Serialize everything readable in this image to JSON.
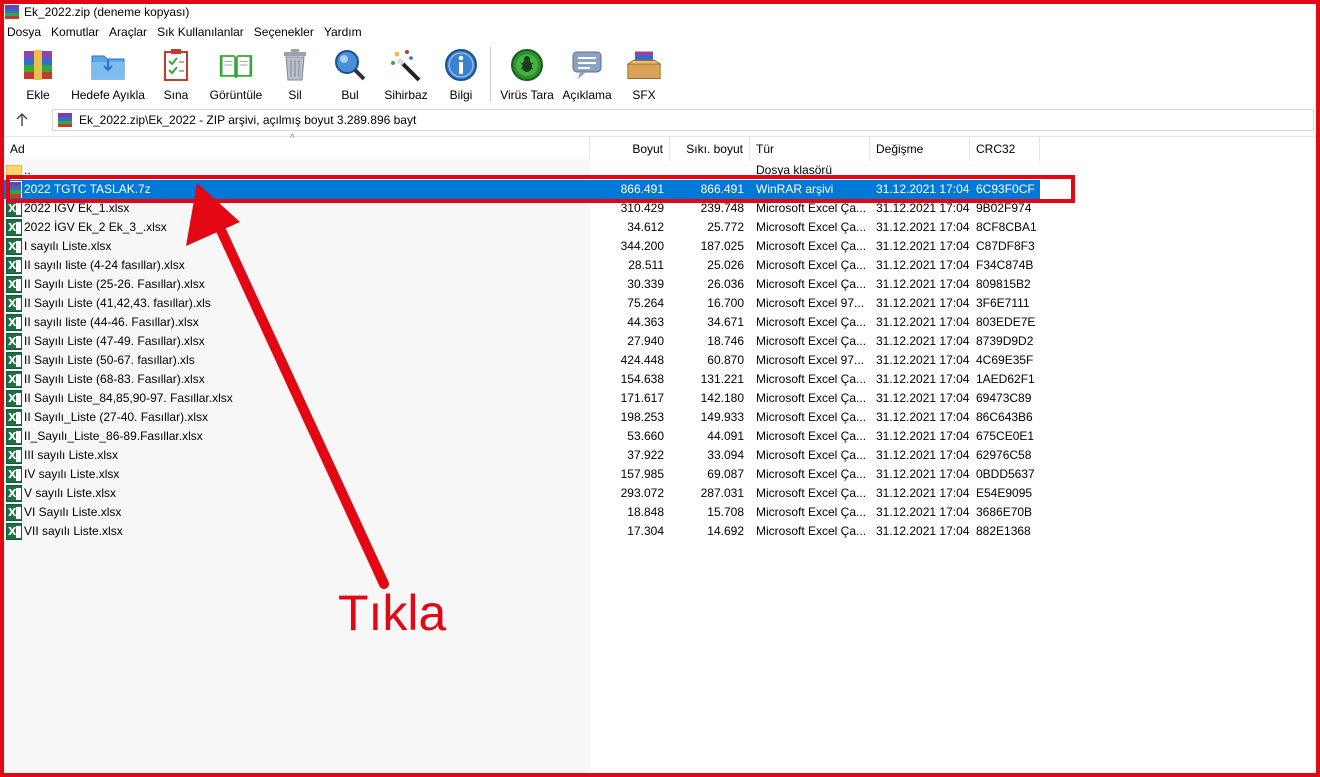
{
  "window": {
    "title": "Ek_2022.zip (deneme kopyası)"
  },
  "menu": [
    "Dosya",
    "Komutlar",
    "Araçlar",
    "Sık Kullanılanlar",
    "Seçenekler",
    "Yardım"
  ],
  "toolbar": [
    {
      "label": "Ekle",
      "icon": "add-archive-icon"
    },
    {
      "label": "Hedefe Ayıkla",
      "icon": "extract-folder-icon"
    },
    {
      "label": "Sına",
      "icon": "test-checklist-icon"
    },
    {
      "label": "Görüntüle",
      "icon": "view-book-icon"
    },
    {
      "label": "Sil",
      "icon": "trash-icon"
    },
    {
      "label": "Bul",
      "icon": "search-magnifier-icon"
    },
    {
      "label": "Sihirbaz",
      "icon": "wizard-wand-icon"
    },
    {
      "label": "Bilgi",
      "icon": "info-icon"
    },
    {
      "label": "Virüs Tara",
      "icon": "virus-scan-icon"
    },
    {
      "label": "Açıklama",
      "icon": "comment-icon"
    },
    {
      "label": "SFX",
      "icon": "sfx-box-icon"
    }
  ],
  "path": {
    "text": "Ek_2022.zip\\Ek_2022 - ZIP arşivi, açılmış boyut 3.289.896 bayt"
  },
  "columns": {
    "name": "Ad",
    "size": "Boyut",
    "packed": "Sıkı. boyut",
    "type": "Tür",
    "modified": "Değişme",
    "crc": "CRC32"
  },
  "files": [
    {
      "name": "..",
      "size": "",
      "packed": "",
      "type": "Dosya klasörü",
      "modified": "",
      "crc": "",
      "icon": "folder"
    },
    {
      "name": "2022 TGTC TASLAK.7z",
      "size": "866.491",
      "packed": "866.491",
      "type": "WinRAR arşivi",
      "modified": "31.12.2021 17:04",
      "crc": "6C93F0CF",
      "icon": "rar",
      "selected": true
    },
    {
      "name": "2022 İGV  Ek_1.xlsx",
      "size": "310.429",
      "packed": "239.748",
      "type": "Microsoft Excel Ça...",
      "modified": "31.12.2021 17:04",
      "crc": "9B02F974",
      "icon": "excel"
    },
    {
      "name": "2022 İGV Ek_2 Ek_3_.xlsx",
      "size": "34.612",
      "packed": "25.772",
      "type": "Microsoft Excel Ça...",
      "modified": "31.12.2021 17:04",
      "crc": "8CF8CBA1",
      "icon": "excel"
    },
    {
      "name": "I sayılı Liste.xlsx",
      "size": "344.200",
      "packed": "187.025",
      "type": "Microsoft Excel Ça...",
      "modified": "31.12.2021 17:04",
      "crc": "C87DF8F3",
      "icon": "excel"
    },
    {
      "name": "II sayılı liste (4-24 fasıllar).xlsx",
      "size": "28.511",
      "packed": "25.026",
      "type": "Microsoft Excel Ça...",
      "modified": "31.12.2021 17:04",
      "crc": "F34C874B",
      "icon": "excel"
    },
    {
      "name": "II Sayılı Liste (25-26. Fasıllar).xlsx",
      "size": "30.339",
      "packed": "26.036",
      "type": "Microsoft Excel Ça...",
      "modified": "31.12.2021 17:04",
      "crc": "809815B2",
      "icon": "excel"
    },
    {
      "name": "II Sayılı Liste (41,42,43. fasıllar).xls",
      "size": "75.264",
      "packed": "16.700",
      "type": "Microsoft Excel 97...",
      "modified": "31.12.2021 17:04",
      "crc": "3F6E7111",
      "icon": "excel"
    },
    {
      "name": "II sayılı liste (44-46. Fasıllar).xlsx",
      "size": "44.363",
      "packed": "34.671",
      "type": "Microsoft Excel Ça...",
      "modified": "31.12.2021 17:04",
      "crc": "803EDE7E",
      "icon": "excel"
    },
    {
      "name": "II Sayılı Liste (47-49. Fasıllar).xlsx",
      "size": "27.940",
      "packed": "18.746",
      "type": "Microsoft Excel Ça...",
      "modified": "31.12.2021 17:04",
      "crc": "8739D9D2",
      "icon": "excel"
    },
    {
      "name": "II Sayılı Liste (50-67. fasıllar).xls",
      "size": "424.448",
      "packed": "60.870",
      "type": "Microsoft Excel 97...",
      "modified": "31.12.2021 17:04",
      "crc": "4C69E35F",
      "icon": "excel"
    },
    {
      "name": "II Sayılı Liste (68-83. Fasıllar).xlsx",
      "size": "154.638",
      "packed": "131.221",
      "type": "Microsoft Excel Ça...",
      "modified": "31.12.2021 17:04",
      "crc": "1AED62F1",
      "icon": "excel"
    },
    {
      "name": "II Sayılı Liste_84,85,90-97. Fasıllar.xlsx",
      "size": "171.617",
      "packed": "142.180",
      "type": "Microsoft Excel Ça...",
      "modified": "31.12.2021 17:04",
      "crc": "69473C89",
      "icon": "excel"
    },
    {
      "name": "II Sayılı_Liste (27-40. Fasıllar).xlsx",
      "size": "198.253",
      "packed": "149.933",
      "type": "Microsoft Excel Ça...",
      "modified": "31.12.2021 17:04",
      "crc": "86C643B6",
      "icon": "excel"
    },
    {
      "name": "II_Sayılı_Liste_86-89.Fasıllar.xlsx",
      "size": "53.660",
      "packed": "44.091",
      "type": "Microsoft Excel Ça...",
      "modified": "31.12.2021 17:04",
      "crc": "675CE0E1",
      "icon": "excel"
    },
    {
      "name": "III sayılı Liste.xlsx",
      "size": "37.922",
      "packed": "33.094",
      "type": "Microsoft Excel Ça...",
      "modified": "31.12.2021 17:04",
      "crc": "62976C58",
      "icon": "excel"
    },
    {
      "name": "IV sayılı Liste.xlsx",
      "size": "157.985",
      "packed": "69.087",
      "type": "Microsoft Excel Ça...",
      "modified": "31.12.2021 17:04",
      "crc": "0BDD5637",
      "icon": "excel"
    },
    {
      "name": "V sayılı Liste.xlsx",
      "size": "293.072",
      "packed": "287.031",
      "type": "Microsoft Excel Ça...",
      "modified": "31.12.2021 17:04",
      "crc": "E54E9095",
      "icon": "excel"
    },
    {
      "name": "VI Sayılı Liste.xlsx",
      "size": "18.848",
      "packed": "15.708",
      "type": "Microsoft Excel Ça...",
      "modified": "31.12.2021 17:04",
      "crc": "3686E70B",
      "icon": "excel"
    },
    {
      "name": "VII sayılı Liste.xlsx",
      "size": "17.304",
      "packed": "14.692",
      "type": "Microsoft Excel Ça...",
      "modified": "31.12.2021 17:04",
      "crc": "882E1368",
      "icon": "excel"
    }
  ],
  "annotation": {
    "label": "Tıkla",
    "color": "#e30613"
  },
  "colors": {
    "selection": "#0078d7",
    "annotation_red": "#e30613"
  }
}
